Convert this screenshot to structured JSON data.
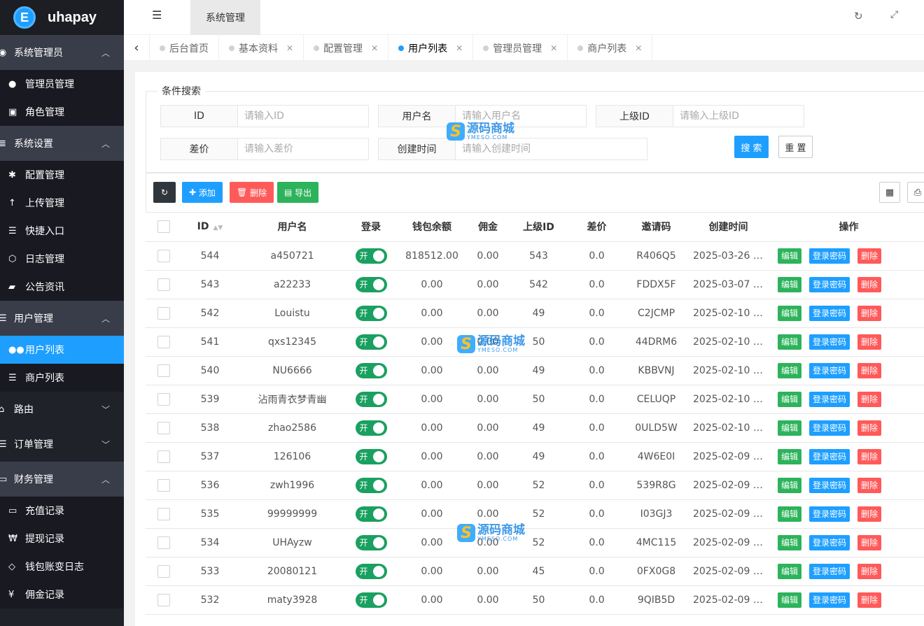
{
  "app": {
    "name": "uhapay",
    "logo_letter": "E"
  },
  "topbar": {
    "active_tab": "系统管理"
  },
  "sidebar": {
    "groups": [
      {
        "label": "系统管理员",
        "icon": "user-circle-icon",
        "expanded": true,
        "items": [
          {
            "label": "管理员管理",
            "icon": "user-icon"
          },
          {
            "label": "角色管理",
            "icon": "role-icon"
          }
        ]
      },
      {
        "label": "系统设置",
        "icon": "database-icon",
        "expanded": true,
        "items": [
          {
            "label": "配置管理",
            "icon": "asterisk-icon"
          },
          {
            "label": "上传管理",
            "icon": "upload-arrow-icon"
          },
          {
            "label": "快捷入口",
            "icon": "list-icon"
          },
          {
            "label": "日志管理",
            "icon": "log-icon"
          },
          {
            "label": "公告资讯",
            "icon": "book-icon"
          }
        ]
      },
      {
        "label": "用户管理",
        "icon": "list-icon",
        "expanded": true,
        "items": [
          {
            "label": "用户列表",
            "icon": "users-icon",
            "active": true
          },
          {
            "label": "商户列表",
            "icon": "list-icon"
          }
        ]
      },
      {
        "label": "路由",
        "icon": "bank-icon",
        "expanded": false,
        "items": []
      },
      {
        "label": "订单管理",
        "icon": "list-icon",
        "expanded": false,
        "items": []
      },
      {
        "label": "财务管理",
        "icon": "money-icon",
        "expanded": true,
        "items": [
          {
            "label": "充值记录",
            "icon": "card-icon"
          },
          {
            "label": "提现记录",
            "icon": "won-icon"
          },
          {
            "label": "钱包账变日志",
            "icon": "diamond-icon"
          },
          {
            "label": "佣金记录",
            "icon": "yen-icon"
          }
        ]
      }
    ]
  },
  "page_tabs": [
    {
      "label": "后台首页",
      "closable": false,
      "active": false
    },
    {
      "label": "基本资料",
      "closable": true,
      "active": false
    },
    {
      "label": "配置管理",
      "closable": true,
      "active": false
    },
    {
      "label": "用户列表",
      "closable": true,
      "active": true
    },
    {
      "label": "管理员管理",
      "closable": true,
      "active": false
    },
    {
      "label": "商户列表",
      "closable": true,
      "active": false
    }
  ],
  "search": {
    "legend": "条件搜索",
    "fields": {
      "id": {
        "label": "ID",
        "placeholder": "请输入ID"
      },
      "username": {
        "label": "用户名",
        "placeholder": "请输入用户名"
      },
      "parent_id": {
        "label": "上级ID",
        "placeholder": "请输入上级ID"
      },
      "price_diff": {
        "label": "差价",
        "placeholder": "请输入差价"
      },
      "created": {
        "label": "创建时间",
        "placeholder": "请输入创建时间"
      }
    },
    "search_btn": "搜 索",
    "reset_btn": "重 置"
  },
  "toolbar": {
    "add": "添加",
    "delete": "删除",
    "export": "导出"
  },
  "table": {
    "columns": [
      "ID",
      "用户名",
      "登录",
      "钱包余额",
      "佣金",
      "上级ID",
      "差价",
      "邀请码",
      "创建时间",
      "操作"
    ],
    "switch_label": "开",
    "op_labels": {
      "edit": "编辑",
      "pwd": "登录密码",
      "del": "删除"
    },
    "rows": [
      {
        "id": "544",
        "username": "a450721",
        "balance": "818512.00",
        "commission": "0.00",
        "parent": "543",
        "diff": "0.0",
        "code": "R406Q5",
        "created": "2025-03-26 2..."
      },
      {
        "id": "543",
        "username": "a22233",
        "balance": "0.00",
        "commission": "0.00",
        "parent": "542",
        "diff": "0.0",
        "code": "FDDX5F",
        "created": "2025-03-07 0..."
      },
      {
        "id": "542",
        "username": "Louistu",
        "balance": "0.00",
        "commission": "0.00",
        "parent": "49",
        "diff": "0.0",
        "code": "C2JCMP",
        "created": "2025-02-10 2..."
      },
      {
        "id": "541",
        "username": "qxs12345",
        "balance": "0.00",
        "commission": "0.00",
        "parent": "50",
        "diff": "0.0",
        "code": "44DRM6",
        "created": "2025-02-10 1..."
      },
      {
        "id": "540",
        "username": "NU6666",
        "balance": "0.00",
        "commission": "0.00",
        "parent": "49",
        "diff": "0.0",
        "code": "KBBVNJ",
        "created": "2025-02-10 1..."
      },
      {
        "id": "539",
        "username": "沾雨青衣梦青幽",
        "balance": "0.00",
        "commission": "0.00",
        "parent": "50",
        "diff": "0.0",
        "code": "CELUQP",
        "created": "2025-02-10 1..."
      },
      {
        "id": "538",
        "username": "zhao2586",
        "balance": "0.00",
        "commission": "0.00",
        "parent": "49",
        "diff": "0.0",
        "code": "0ULD5W",
        "created": "2025-02-10 1..."
      },
      {
        "id": "537",
        "username": "126106",
        "balance": "0.00",
        "commission": "0.00",
        "parent": "49",
        "diff": "0.0",
        "code": "4W6E0I",
        "created": "2025-02-09 2..."
      },
      {
        "id": "536",
        "username": "zwh1996",
        "balance": "0.00",
        "commission": "0.00",
        "parent": "52",
        "diff": "0.0",
        "code": "539R8G",
        "created": "2025-02-09 2..."
      },
      {
        "id": "535",
        "username": "99999999",
        "balance": "0.00",
        "commission": "0.00",
        "parent": "52",
        "diff": "0.0",
        "code": "I03GJ3",
        "created": "2025-02-09 2..."
      },
      {
        "id": "534",
        "username": "UHAyzw",
        "balance": "0.00",
        "commission": "0.00",
        "parent": "52",
        "diff": "0.0",
        "code": "4MC115",
        "created": "2025-02-09 2..."
      },
      {
        "id": "533",
        "username": "20080121",
        "balance": "0.00",
        "commission": "0.00",
        "parent": "45",
        "diff": "0.0",
        "code": "0FX0G8",
        "created": "2025-02-09 2..."
      },
      {
        "id": "532",
        "username": "maty3928",
        "balance": "0.00",
        "commission": "0.00",
        "parent": "50",
        "diff": "0.0",
        "code": "9QIB5D",
        "created": "2025-02-09 1..."
      }
    ]
  },
  "watermark": {
    "cn": "源码商城",
    "en": "YMESO.COM",
    "letter": "S"
  },
  "colors": {
    "primary": "#1e9fff",
    "success": "#2db35b",
    "danger": "#ff5a5a",
    "sidebar": "#20222a",
    "switch_on": "#1aa060"
  }
}
